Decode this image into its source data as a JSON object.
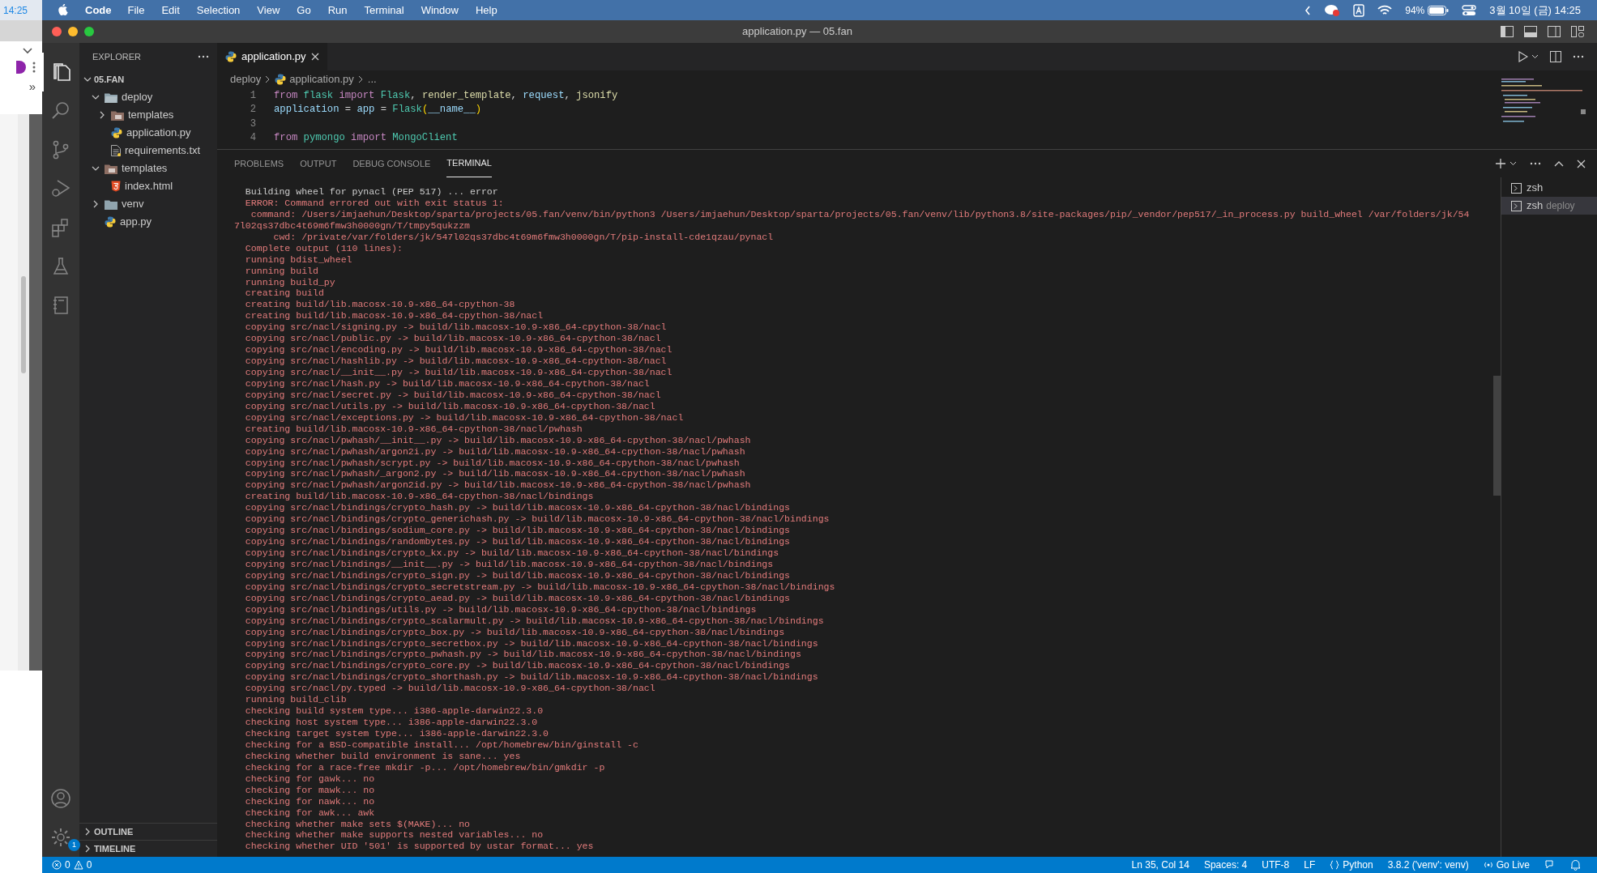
{
  "left_strip": {
    "clock": "14:25",
    "overflow": "»"
  },
  "menu_bar": {
    "app": "Code",
    "menus": [
      "File",
      "Edit",
      "Selection",
      "View",
      "Go",
      "Run",
      "Terminal",
      "Window",
      "Help"
    ],
    "battery": "94%",
    "datetime": "3월 10일 (금) 14:25"
  },
  "window": {
    "title": "application.py — 05.fan"
  },
  "activity_bar": {
    "settings_badge": "1"
  },
  "explorer": {
    "title": "EXPLORER",
    "root": {
      "label": "05.FAN",
      "expanded": true
    },
    "tree": [
      {
        "label": "deploy",
        "kind": "folder",
        "expanded": true,
        "children": [
          {
            "label": "templates",
            "kind": "special-folder",
            "expanded": false
          },
          {
            "label": "application.py",
            "kind": "python"
          },
          {
            "label": "requirements.txt",
            "kind": "text"
          }
        ]
      },
      {
        "label": "templates",
        "kind": "special-folder",
        "expanded": true,
        "children": [
          {
            "label": "index.html",
            "kind": "html"
          }
        ]
      },
      {
        "label": "venv",
        "kind": "folder",
        "expanded": false
      },
      {
        "label": "app.py",
        "kind": "python"
      }
    ],
    "sections": [
      {
        "label": "OUTLINE",
        "expanded": false
      },
      {
        "label": "TIMELINE",
        "expanded": false
      }
    ]
  },
  "tabs": [
    {
      "label": "application.py",
      "selected": true
    }
  ],
  "breadcrumb": [
    "deploy",
    "application.py",
    "..."
  ],
  "code_lines": [
    {
      "number": "1",
      "tokens": [
        {
          "text": "from ",
          "kind": "keyword"
        },
        {
          "text": "flask ",
          "kind": "type"
        },
        {
          "text": "import ",
          "kind": "keyword"
        },
        {
          "text": "Flask",
          "kind": "type"
        },
        {
          "text": ", ",
          "kind": "plain"
        },
        {
          "text": "render_template",
          "kind": "function"
        },
        {
          "text": ", ",
          "kind": "plain"
        },
        {
          "text": "request",
          "kind": "variable"
        },
        {
          "text": ", ",
          "kind": "plain"
        },
        {
          "text": "jsonify",
          "kind": "function"
        }
      ]
    },
    {
      "number": "2",
      "tokens": [
        {
          "text": "application",
          "kind": "variable"
        },
        {
          "text": " = ",
          "kind": "plain"
        },
        {
          "text": "app",
          "kind": "variable"
        },
        {
          "text": " = ",
          "kind": "plain"
        },
        {
          "text": "Flask",
          "kind": "type"
        },
        {
          "text": "(",
          "kind": "bracket"
        },
        {
          "text": "__name__",
          "kind": "variable"
        },
        {
          "text": ")",
          "kind": "bracket"
        }
      ]
    },
    {
      "number": "3"
    },
    {
      "number": "4",
      "tokens": [
        {
          "text": "from ",
          "kind": "keyword"
        },
        {
          "text": "pymongo ",
          "kind": "type"
        },
        {
          "text": "import ",
          "kind": "keyword"
        },
        {
          "text": "MongoClient",
          "kind": "type"
        }
      ]
    }
  ],
  "panel": {
    "tabs": [
      {
        "label": "PROBLEMS",
        "selected": false
      },
      {
        "label": "OUTPUT",
        "selected": false
      },
      {
        "label": "DEBUG CONSOLE",
        "selected": false
      },
      {
        "label": "TERMINAL",
        "selected": true
      }
    ],
    "terminal_lines": [
      {
        "text": "  Building wheel for pynacl (PEP 517) ... error",
        "kind": "info"
      },
      {
        "text": "  ERROR: Command errored out with exit status 1:",
        "kind": "error"
      },
      {
        "text": "   command: /Users/imjaehun/Desktop/sparta/projects/05.fan/venv/bin/python3 /Users/imjaehun/Desktop/sparta/projects/05.fan/venv/lib/python3.8/site-packages/pip/_vendor/pep517/_in_process.py build_wheel /var/folders/jk/54",
        "kind": "error"
      },
      {
        "text": "7l02qs37dbc4t69m6fmw3h0000gn/T/tmpy5qukzzm",
        "kind": "error"
      },
      {
        "text": "       cwd: /private/var/folders/jk/547l02qs37dbc4t69m6fmw3h0000gn/T/pip-install-cde1qzau/pynacl",
        "kind": "error"
      },
      {
        "text": "  Complete output (110 lines):",
        "kind": "error"
      },
      {
        "text": "  running bdist_wheel",
        "kind": "error"
      },
      {
        "text": "  running build",
        "kind": "error"
      },
      {
        "text": "  running build_py",
        "kind": "error"
      },
      {
        "text": "  creating build",
        "kind": "error"
      },
      {
        "text": "  creating build/lib.macosx-10.9-x86_64-cpython-38",
        "kind": "error"
      },
      {
        "text": "  creating build/lib.macosx-10.9-x86_64-cpython-38/nacl",
        "kind": "error"
      },
      {
        "text": "  copying src/nacl/signing.py -> build/lib.macosx-10.9-x86_64-cpython-38/nacl",
        "kind": "error"
      },
      {
        "text": "  copying src/nacl/public.py -> build/lib.macosx-10.9-x86_64-cpython-38/nacl",
        "kind": "error"
      },
      {
        "text": "  copying src/nacl/encoding.py -> build/lib.macosx-10.9-x86_64-cpython-38/nacl",
        "kind": "error"
      },
      {
        "text": "  copying src/nacl/hashlib.py -> build/lib.macosx-10.9-x86_64-cpython-38/nacl",
        "kind": "error"
      },
      {
        "text": "  copying src/nacl/__init__.py -> build/lib.macosx-10.9-x86_64-cpython-38/nacl",
        "kind": "error"
      },
      {
        "text": "  copying src/nacl/hash.py -> build/lib.macosx-10.9-x86_64-cpython-38/nacl",
        "kind": "error"
      },
      {
        "text": "  copying src/nacl/secret.py -> build/lib.macosx-10.9-x86_64-cpython-38/nacl",
        "kind": "error"
      },
      {
        "text": "  copying src/nacl/utils.py -> build/lib.macosx-10.9-x86_64-cpython-38/nacl",
        "kind": "error"
      },
      {
        "text": "  copying src/nacl/exceptions.py -> build/lib.macosx-10.9-x86_64-cpython-38/nacl",
        "kind": "error"
      },
      {
        "text": "  creating build/lib.macosx-10.9-x86_64-cpython-38/nacl/pwhash",
        "kind": "error"
      },
      {
        "text": "  copying src/nacl/pwhash/__init__.py -> build/lib.macosx-10.9-x86_64-cpython-38/nacl/pwhash",
        "kind": "error"
      },
      {
        "text": "  copying src/nacl/pwhash/argon2i.py -> build/lib.macosx-10.9-x86_64-cpython-38/nacl/pwhash",
        "kind": "error"
      },
      {
        "text": "  copying src/nacl/pwhash/scrypt.py -> build/lib.macosx-10.9-x86_64-cpython-38/nacl/pwhash",
        "kind": "error"
      },
      {
        "text": "  copying src/nacl/pwhash/_argon2.py -> build/lib.macosx-10.9-x86_64-cpython-38/nacl/pwhash",
        "kind": "error"
      },
      {
        "text": "  copying src/nacl/pwhash/argon2id.py -> build/lib.macosx-10.9-x86_64-cpython-38/nacl/pwhash",
        "kind": "error"
      },
      {
        "text": "  creating build/lib.macosx-10.9-x86_64-cpython-38/nacl/bindings",
        "kind": "error"
      },
      {
        "text": "  copying src/nacl/bindings/crypto_hash.py -> build/lib.macosx-10.9-x86_64-cpython-38/nacl/bindings",
        "kind": "error"
      },
      {
        "text": "  copying src/nacl/bindings/crypto_generichash.py -> build/lib.macosx-10.9-x86_64-cpython-38/nacl/bindings",
        "kind": "error"
      },
      {
        "text": "  copying src/nacl/bindings/sodium_core.py -> build/lib.macosx-10.9-x86_64-cpython-38/nacl/bindings",
        "kind": "error"
      },
      {
        "text": "  copying src/nacl/bindings/randombytes.py -> build/lib.macosx-10.9-x86_64-cpython-38/nacl/bindings",
        "kind": "error"
      },
      {
        "text": "  copying src/nacl/bindings/crypto_kx.py -> build/lib.macosx-10.9-x86_64-cpython-38/nacl/bindings",
        "kind": "error"
      },
      {
        "text": "  copying src/nacl/bindings/__init__.py -> build/lib.macosx-10.9-x86_64-cpython-38/nacl/bindings",
        "kind": "error"
      },
      {
        "text": "  copying src/nacl/bindings/crypto_sign.py -> build/lib.macosx-10.9-x86_64-cpython-38/nacl/bindings",
        "kind": "error"
      },
      {
        "text": "  copying src/nacl/bindings/crypto_secretstream.py -> build/lib.macosx-10.9-x86_64-cpython-38/nacl/bindings",
        "kind": "error"
      },
      {
        "text": "  copying src/nacl/bindings/crypto_aead.py -> build/lib.macosx-10.9-x86_64-cpython-38/nacl/bindings",
        "kind": "error"
      },
      {
        "text": "  copying src/nacl/bindings/utils.py -> build/lib.macosx-10.9-x86_64-cpython-38/nacl/bindings",
        "kind": "error"
      },
      {
        "text": "  copying src/nacl/bindings/crypto_scalarmult.py -> build/lib.macosx-10.9-x86_64-cpython-38/nacl/bindings",
        "kind": "error"
      },
      {
        "text": "  copying src/nacl/bindings/crypto_box.py -> build/lib.macosx-10.9-x86_64-cpython-38/nacl/bindings",
        "kind": "error"
      },
      {
        "text": "  copying src/nacl/bindings/crypto_secretbox.py -> build/lib.macosx-10.9-x86_64-cpython-38/nacl/bindings",
        "kind": "error"
      },
      {
        "text": "  copying src/nacl/bindings/crypto_pwhash.py -> build/lib.macosx-10.9-x86_64-cpython-38/nacl/bindings",
        "kind": "error"
      },
      {
        "text": "  copying src/nacl/bindings/crypto_core.py -> build/lib.macosx-10.9-x86_64-cpython-38/nacl/bindings",
        "kind": "error"
      },
      {
        "text": "  copying src/nacl/bindings/crypto_shorthash.py -> build/lib.macosx-10.9-x86_64-cpython-38/nacl/bindings",
        "kind": "error"
      },
      {
        "text": "  copying src/nacl/py.typed -> build/lib.macosx-10.9-x86_64-cpython-38/nacl",
        "kind": "error"
      },
      {
        "text": "  running build_clib",
        "kind": "error"
      },
      {
        "text": "  checking build system type... i386-apple-darwin22.3.0",
        "kind": "error"
      },
      {
        "text": "  checking host system type... i386-apple-darwin22.3.0",
        "kind": "error"
      },
      {
        "text": "  checking target system type... i386-apple-darwin22.3.0",
        "kind": "error"
      },
      {
        "text": "  checking for a BSD-compatible install... /opt/homebrew/bin/ginstall -c",
        "kind": "error"
      },
      {
        "text": "  checking whether build environment is sane... yes",
        "kind": "error"
      },
      {
        "text": "  checking for a race-free mkdir -p... /opt/homebrew/bin/gmkdir -p",
        "kind": "error"
      },
      {
        "text": "  checking for gawk... no",
        "kind": "error"
      },
      {
        "text": "  checking for mawk... no",
        "kind": "error"
      },
      {
        "text": "  checking for nawk... no",
        "kind": "error"
      },
      {
        "text": "  checking for awk... awk",
        "kind": "error"
      },
      {
        "text": "  checking whether make sets $(MAKE)... no",
        "kind": "error"
      },
      {
        "text": "  checking whether make supports nested variables... no",
        "kind": "error"
      },
      {
        "text": "  checking whether UID '501' is supported by ustar format... yes",
        "kind": "error"
      }
    ],
    "terminals": [
      {
        "name": "zsh",
        "selected": false
      },
      {
        "name": "zsh",
        "detail": "deploy",
        "selected": true
      }
    ]
  },
  "status_bar": {
    "errors": "0",
    "warnings": "0",
    "items": [
      "Ln 35, Col 14",
      "Spaces: 4",
      "UTF-8",
      "LF"
    ],
    "language": "Python",
    "interpreter": "3.8.2 ('venv': venv)",
    "go_live": "Go Live"
  }
}
